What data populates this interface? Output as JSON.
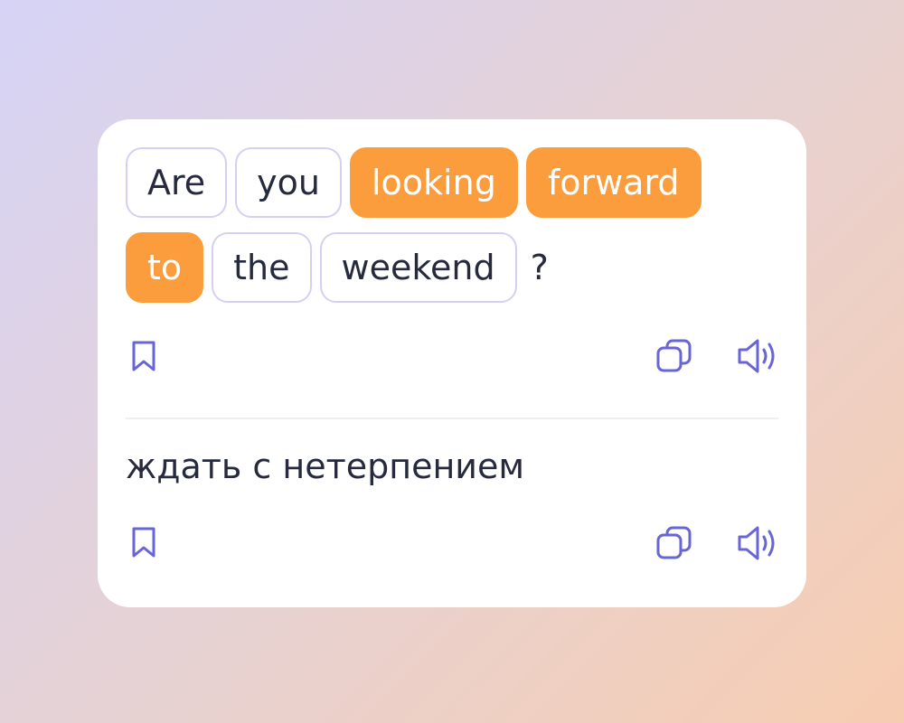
{
  "phrase": {
    "rows": [
      [
        {
          "text": "Are",
          "highlighted": false
        },
        {
          "text": "you",
          "highlighted": false
        },
        {
          "text": "looking",
          "highlighted": true
        },
        {
          "text": "forward",
          "highlighted": true
        }
      ],
      [
        {
          "text": "to",
          "highlighted": true
        },
        {
          "text": "the",
          "highlighted": false
        },
        {
          "text": "weekend",
          "highlighted": false
        }
      ]
    ],
    "punctuation": "?"
  },
  "translation": {
    "text": "ждать с нетерпением"
  },
  "icons": {
    "bookmark": "bookmark-icon",
    "copy": "copy-icon",
    "speaker": "speaker-icon"
  },
  "colors": {
    "highlight": "#fb9d3c",
    "chip_border": "#d4d0f4",
    "icon": "#6865d6",
    "text": "#262a3d"
  }
}
